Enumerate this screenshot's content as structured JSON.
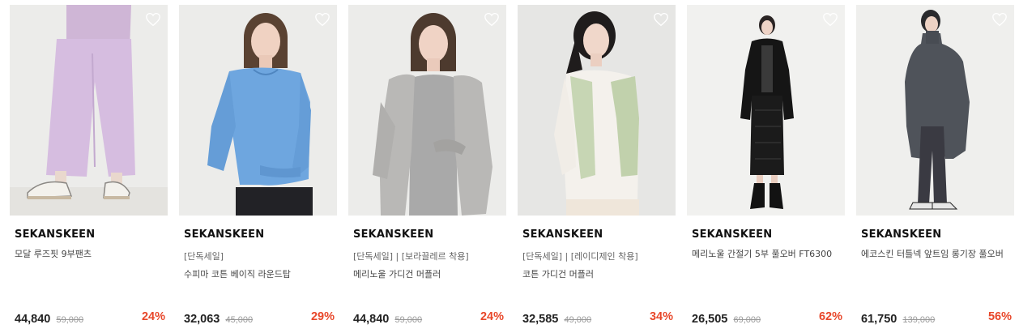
{
  "accent_discount_color": "#e8472a",
  "products": [
    {
      "brand": "SEKANSKEEN",
      "tag": "",
      "name": "모달 루즈핏 9부팬츠",
      "price": "44,840",
      "original_price": "59,000",
      "discount": "24%",
      "wishlist_icon": "heart-outline-icon"
    },
    {
      "brand": "SEKANSKEEN",
      "tag": "[단독세일]",
      "name": "수피마 코튼 베이직 라운드탑",
      "price": "32,063",
      "original_price": "45,000",
      "discount": "29%",
      "wishlist_icon": "heart-outline-icon"
    },
    {
      "brand": "SEKANSKEEN",
      "tag": "[단독세일] | [보라끌레르 착용]",
      "name": "메리노울 가디건 머플러",
      "price": "44,840",
      "original_price": "59,000",
      "discount": "24%",
      "wishlist_icon": "heart-outline-icon"
    },
    {
      "brand": "SEKANSKEEN",
      "tag": "[단독세일] | [레이디제인 착용]",
      "name": "코튼 가디건 머플러",
      "price": "32,585",
      "original_price": "49,000",
      "discount": "34%",
      "wishlist_icon": "heart-outline-icon"
    },
    {
      "brand": "SEKANSKEEN",
      "tag": "",
      "name": "메리노울 간절기 5부 풀오버 FT6300",
      "price": "26,505",
      "original_price": "69,000",
      "discount": "62%",
      "wishlist_icon": "heart-outline-icon"
    },
    {
      "brand": "SEKANSKEEN",
      "tag": "",
      "name": "에코스킨 터틀넥 앞트임 롱기장 풀오버",
      "price": "61,750",
      "original_price": "139,000",
      "discount": "56%",
      "wishlist_icon": "heart-outline-icon"
    }
  ]
}
